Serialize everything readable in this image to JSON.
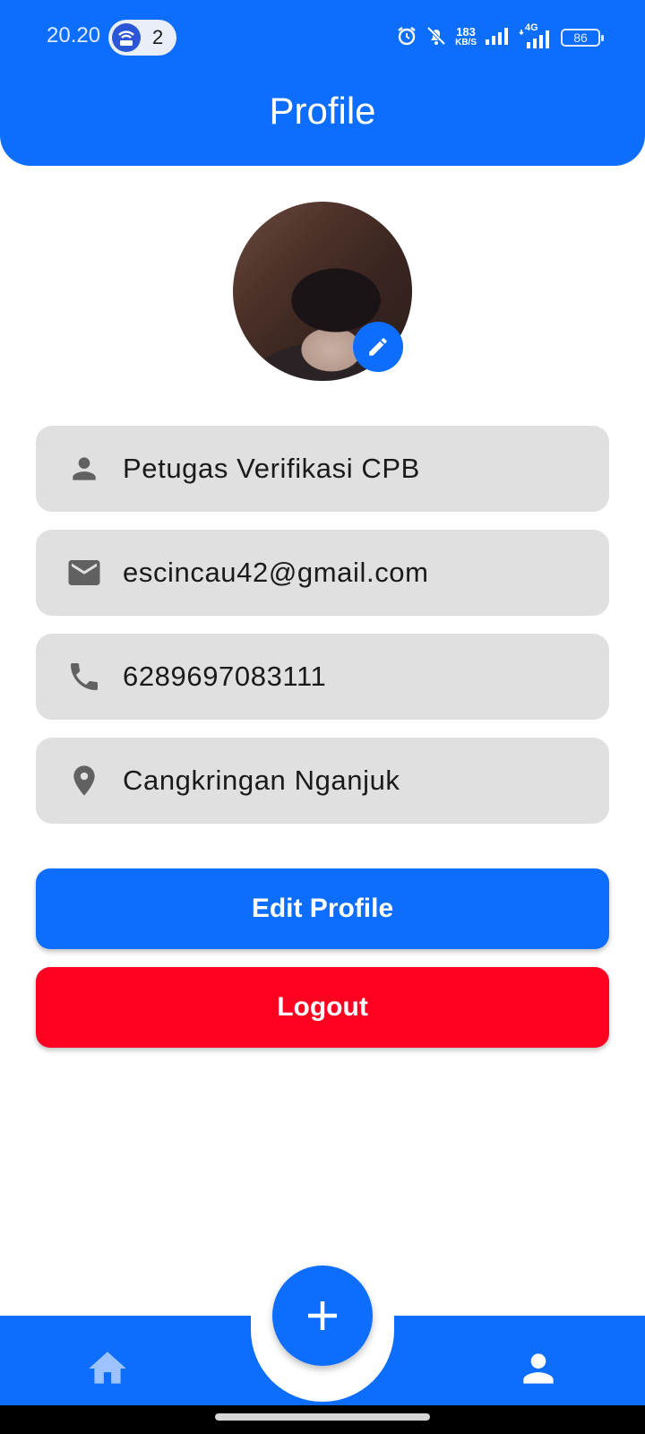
{
  "status_bar": {
    "time": "20.20",
    "hotspot_count": "2",
    "speed_value": "183",
    "speed_unit": "KB/S",
    "network_label": "4G",
    "battery": "86"
  },
  "header": {
    "title": "Profile"
  },
  "profile": {
    "fields": [
      {
        "icon": "person-icon",
        "value": "Petugas Verifikasi CPB"
      },
      {
        "icon": "email-icon",
        "value": "escincau42@gmail.com"
      },
      {
        "icon": "phone-icon",
        "value": "6289697083111"
      },
      {
        "icon": "location-icon",
        "value": "Cangkringan Nganjuk"
      }
    ]
  },
  "actions": {
    "edit_label": "Edit Profile",
    "logout_label": "Logout"
  },
  "bottom_nav": {
    "items": [
      "home-icon",
      "add-icon",
      "profile-icon"
    ]
  },
  "colors": {
    "primary": "#0d6efd",
    "danger": "#ff0020",
    "card": "#e0e0e0",
    "icon_gray": "#616161"
  }
}
